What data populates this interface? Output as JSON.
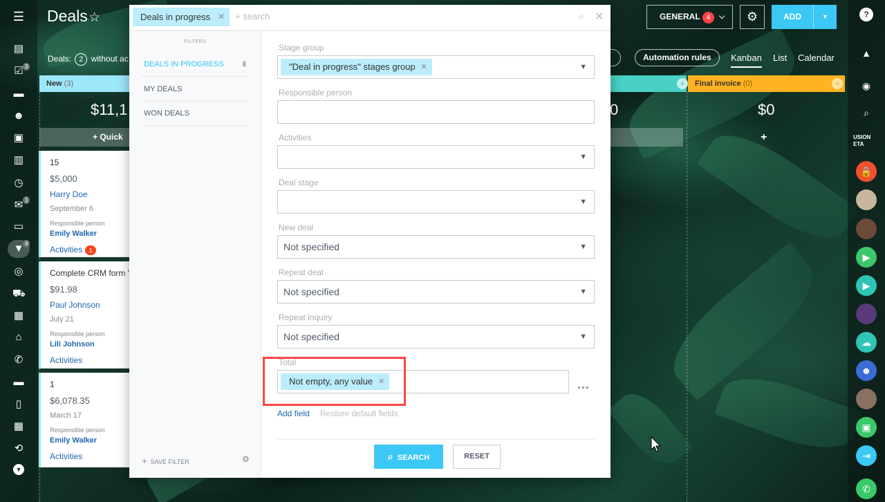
{
  "header": {
    "title": "Deals",
    "general_label": "GENERAL",
    "general_count": "4",
    "add_label": "ADD"
  },
  "toolbar": {
    "deals_prefix": "Deals:",
    "deals_count": "2",
    "deals_suffix": "without ac",
    "automation_label": "Automation rules",
    "views": [
      "Kanban",
      "List",
      "Calendar"
    ]
  },
  "left_badges": {
    "tasks": "3",
    "mail": "1",
    "crm": "4"
  },
  "columns": {
    "new": {
      "name": "New",
      "count": "(3)",
      "sum": "$11,1",
      "quick": "+ Quick D"
    },
    "hidden_sum": "0",
    "final": {
      "name": "Final invoice",
      "count": "(0)",
      "sum": "$0"
    }
  },
  "cards": [
    {
      "title": "15",
      "price": "$5,000",
      "client": "Harry Doe",
      "date": "September 6",
      "resp_label": "Responsible person",
      "resp": "Emily Walker",
      "act": "Activities",
      "act_count": "1"
    },
    {
      "title": "Complete CRM form '",
      "price": "$91.98",
      "client": "Paul Johnson",
      "date": "July 21",
      "resp_label": "Responsible person",
      "resp": "Lili Johnson",
      "act": "Activities"
    },
    {
      "title": "1",
      "price": "$6,078.35",
      "client": "",
      "date": "March 17",
      "resp_label": "Responsible person",
      "resp": "Emily Walker",
      "act": "Activities"
    }
  ],
  "filter": {
    "search_tag": "Deals in progress",
    "search_placeholder": "+ search",
    "presets_title": "FILTERS",
    "presets": [
      "DEALS IN PROGRESS",
      "MY DEALS",
      "WON DEALS"
    ],
    "save_filter": "SAVE FILTER",
    "fields": {
      "stage_group": {
        "label": "Stage group",
        "tag": "\"Deal in progress\" stages group"
      },
      "responsible": {
        "label": "Responsible person"
      },
      "activities": {
        "label": "Activities"
      },
      "deal_stage": {
        "label": "Deal stage"
      },
      "new_deal": {
        "label": "New deal",
        "value": "Not specified"
      },
      "repeat_deal": {
        "label": "Repeat deal",
        "value": "Not specified"
      },
      "repeat_inquiry": {
        "label": "Repeat inquiry",
        "value": "Not specified"
      },
      "total": {
        "label": "Total",
        "tag": "Not empty, any value"
      }
    },
    "add_field": "Add field",
    "restore": "Restore default fields",
    "search_btn": "SEARCH",
    "reset_btn": "RESET"
  },
  "right_bar": {
    "brand_text": "USION\nETA"
  },
  "colors": {
    "accent": "#3bc8f5",
    "new_col": "#9de7fb",
    "final_col": "#ffb321",
    "teal_col": "#48d1c4",
    "badge": "#f44336"
  }
}
